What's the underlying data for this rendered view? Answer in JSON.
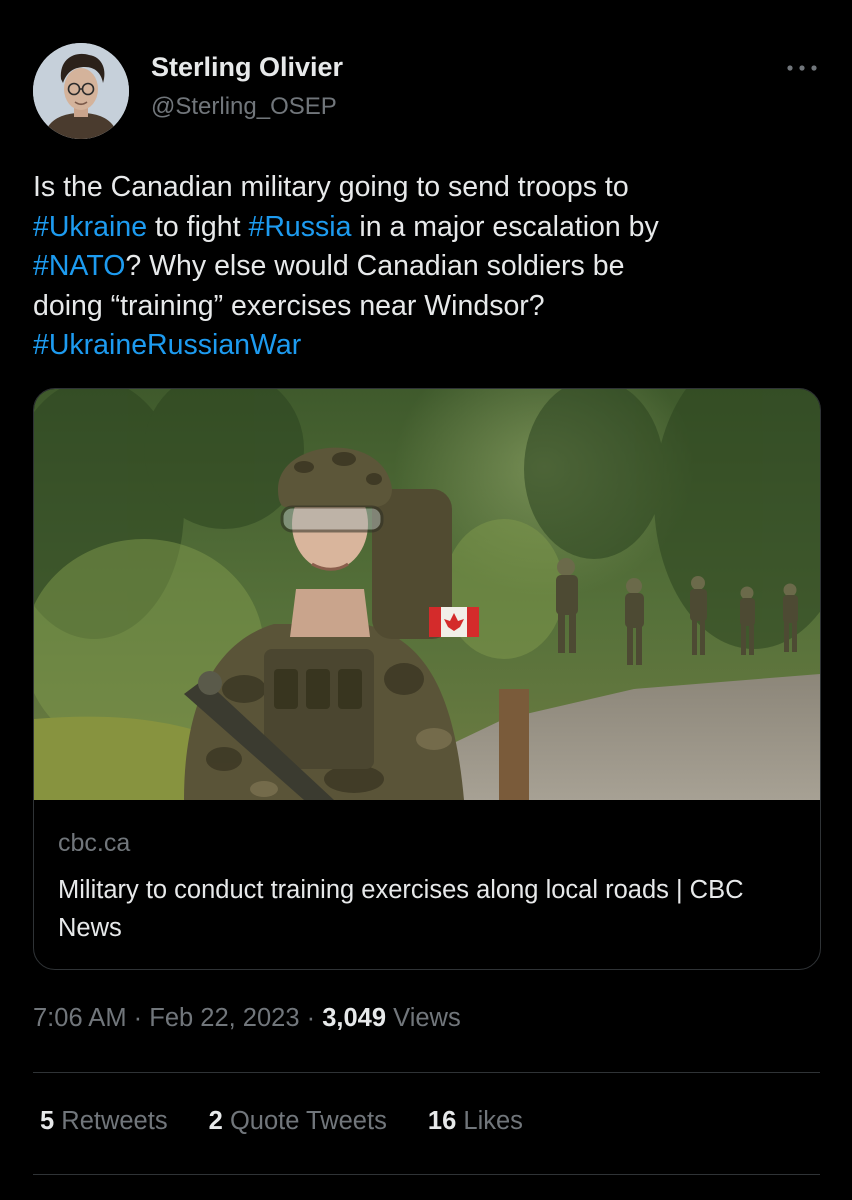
{
  "author": {
    "display_name": "Sterling Olivier",
    "handle": "@Sterling_OSEP",
    "avatar_icon": "user-portrait-avatar"
  },
  "more_icon": "ellipsis-icon",
  "tweet": {
    "lines": [
      [
        {
          "text": "Is the Canadian military going to send troops to",
          "hashtag": false
        }
      ],
      [
        {
          "text": "#Ukraine",
          "hashtag": true
        },
        {
          "text": " to fight ",
          "hashtag": false
        },
        {
          "text": "#Russia",
          "hashtag": true
        },
        {
          "text": " in a major escalation by",
          "hashtag": false
        }
      ],
      [
        {
          "text": "#NATO",
          "hashtag": true
        },
        {
          "text": "? Why else would Canadian soldiers be",
          "hashtag": false
        }
      ],
      [
        {
          "text": "doing “training” exercises near Windsor?",
          "hashtag": false
        }
      ],
      [
        {
          "text": "#UkraineRussianWar",
          "hashtag": true
        }
      ]
    ]
  },
  "card": {
    "domain": "cbc.ca",
    "title": "Military to conduct training exercises along local roads | CBC News",
    "image_subject": "soldiers-marching-photo"
  },
  "meta": {
    "time": "7:06 AM",
    "separator": "·",
    "date": "Feb 22, 2023",
    "views_count": "3,049",
    "views_label": "Views"
  },
  "stats": {
    "retweets_count": "5",
    "retweets_label": "Retweets",
    "quotes_count": "2",
    "quotes_label": "Quote Tweets",
    "likes_count": "16",
    "likes_label": "Likes"
  },
  "colors": {
    "background": "#000000",
    "text": "#e7e9ea",
    "muted": "#71767b",
    "hashtag": "#1d9bf0",
    "border": "#2f3336"
  }
}
